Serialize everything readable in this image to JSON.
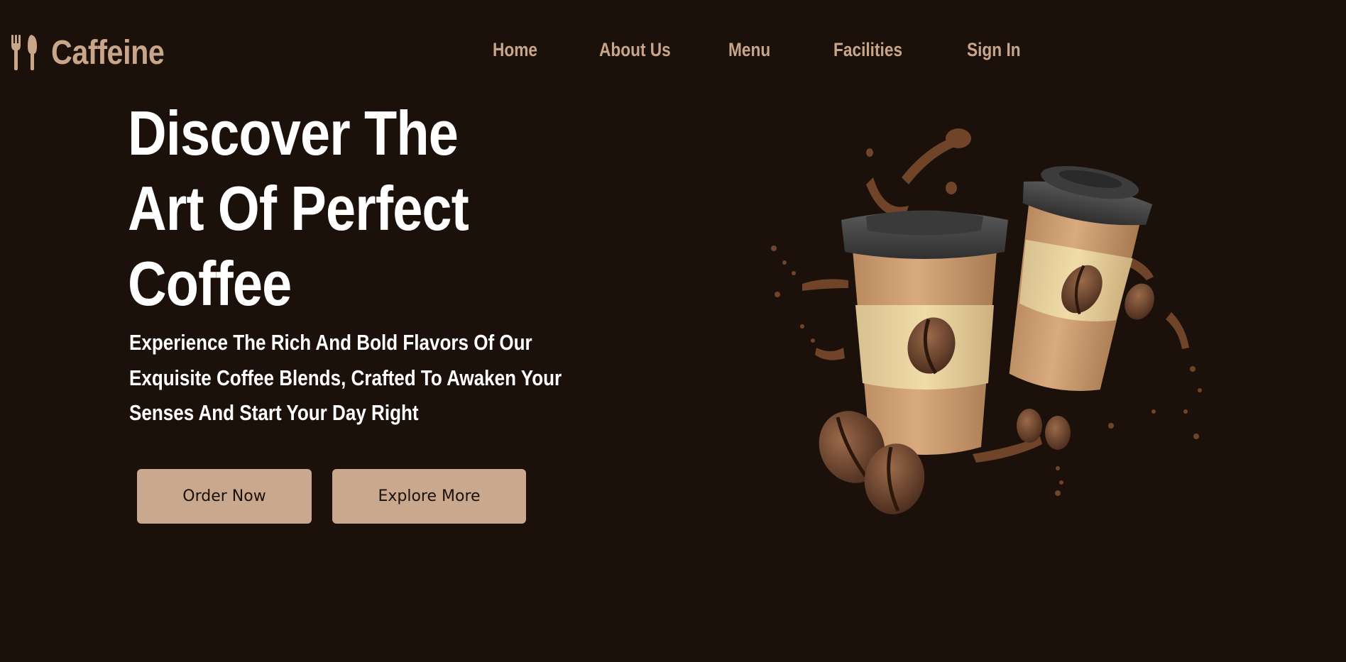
{
  "brand": {
    "name": "Caffeine",
    "icon": "fork-knife-icon"
  },
  "nav": {
    "items": [
      {
        "label": "Home"
      },
      {
        "label": "About Us"
      },
      {
        "label": "Menu"
      },
      {
        "label": "Facilities"
      },
      {
        "label": "Sign In"
      }
    ]
  },
  "hero": {
    "title_lines": [
      "Discover The",
      "Art Of Perfect",
      "Coffee"
    ],
    "subtitle_lines": [
      "Experience The Rich And Bold Flavors Of Our",
      "Exquisite Coffee Blends, Crafted To Awaken Your",
      "Senses And Start Your Day Right"
    ],
    "buttons": {
      "order": "Order Now",
      "explore": "Explore More"
    },
    "illustration": "coffee-cups-illustration"
  },
  "colors": {
    "background": "#1b110a",
    "accent": "#c9a58a",
    "button_bg": "#c9a88d",
    "text": "#ffffff"
  }
}
